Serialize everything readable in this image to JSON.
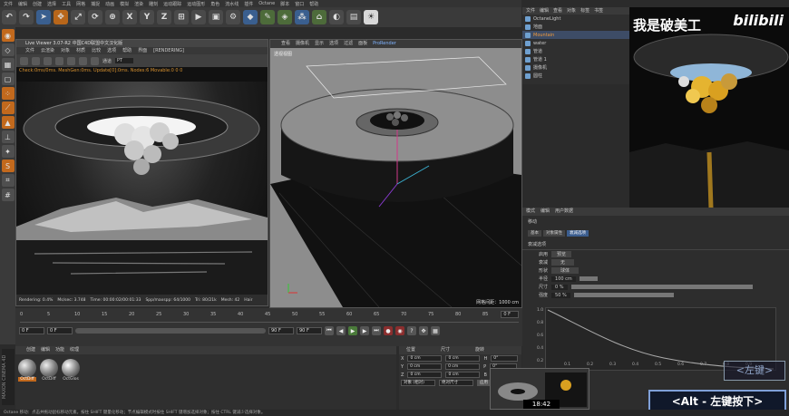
{
  "menu": {
    "items": [
      "文件",
      "编辑",
      "创建",
      "选择",
      "工具",
      "网格",
      "捕捉",
      "动画",
      "模拟",
      "渲染",
      "雕刻",
      "运动跟踪",
      "运动图形",
      "角色",
      "流水线",
      "插件",
      "Octane",
      "脚本",
      "窗口",
      "帮助"
    ]
  },
  "toolbar": {
    "axis": [
      "X",
      "Y",
      "Z"
    ]
  },
  "live_viewer": {
    "title": "Live Viewer 3.07-R2 中国C4D联盟中文汉化版",
    "menu": [
      "文件",
      "云渲染",
      "对象",
      "材质",
      "比较",
      "选项",
      "帮助",
      "界面"
    ],
    "status_tag": "[RENDERING]",
    "mode": "通道",
    "mode_value": "PT",
    "info": "Check:0ms/0ms. MeshGen:0ms. Update[0]:0ms. Nodes:6 Movable:0 0 0",
    "status": [
      "Rendering: 0.4%",
      "Ms/sec: 3.748",
      "Time: 00:00:02/00:01:33",
      "Spp/maxspp: 64/1000",
      "Tri: 80/21k",
      "Mesh: 42",
      "Hair"
    ]
  },
  "viewport": {
    "menu": [
      "查看",
      "摄像机",
      "显示",
      "选项",
      "过滤",
      "面板",
      "ProRender"
    ],
    "label": "透视视图",
    "grid": "网格间距：1000 cm"
  },
  "timeline": {
    "ticks": [
      "0",
      "5",
      "10",
      "15",
      "20",
      "25",
      "30",
      "35",
      "40",
      "45",
      "50",
      "55",
      "60",
      "65",
      "70",
      "75",
      "80",
      "85",
      "90"
    ],
    "start": "0 F",
    "mid": "0 F",
    "end": "90 F",
    "end2": "90 F",
    "current": "0 F"
  },
  "materials": {
    "tabs": [
      "创建",
      "编辑",
      "功能",
      "纹理"
    ],
    "items": [
      {
        "name": "OctDiff",
        "selected": true
      },
      {
        "name": "OctDiff",
        "selected": false
      },
      {
        "name": "OctGlos",
        "selected": false
      }
    ]
  },
  "coordinates": {
    "headers": [
      "位置",
      "尺寸",
      "旋转"
    ],
    "rows": [
      {
        "axis": "X",
        "pos": "0 cm",
        "size": "0 cm",
        "rot_label": "H",
        "rot": "0°"
      },
      {
        "axis": "Y",
        "pos": "0 cm",
        "size": "0 cm",
        "rot_label": "P",
        "rot": "0°"
      },
      {
        "axis": "Z",
        "pos": "0 cm",
        "size": "0 cm",
        "rot_label": "B",
        "rot": "0°"
      }
    ],
    "mode1": "对象 (相对)",
    "mode2": "绝对尺寸",
    "apply": "应用"
  },
  "objects": {
    "menu": [
      "文件",
      "编辑",
      "查看",
      "对象",
      "标签",
      "书签"
    ],
    "items": [
      {
        "name": "OctaneLight",
        "selected": false
      },
      {
        "name": "地面",
        "selected": false
      },
      {
        "name": "Mountain",
        "selected": true
      },
      {
        "name": "water",
        "selected": false
      },
      {
        "name": "管道",
        "selected": false
      },
      {
        "name": "管道 1",
        "selected": false
      },
      {
        "name": "摄像机",
        "selected": false
      },
      {
        "name": "圆柱",
        "selected": false
      }
    ]
  },
  "camera_preview": {
    "title": "我是破美工",
    "logo": "bilibili"
  },
  "attributes": {
    "tabs": [
      "模式",
      "编辑",
      "用户数据"
    ],
    "object": "移动",
    "subtabs": [
      "基本",
      "对象属性",
      "衰减选项"
    ],
    "section": "衰减选项",
    "rows": [
      {
        "label": "启用",
        "value": "预览"
      },
      {
        "label": "衰减",
        "value": "无"
      },
      {
        "label": "形状",
        "value": "球体"
      },
      {
        "label": "半径",
        "value": "100 cm"
      },
      {
        "label": "尺寸",
        "value": "0 %"
      },
      {
        "label": "强度",
        "value": "50 %"
      }
    ],
    "graph_y": [
      "1.0",
      "0.8",
      "0.6",
      "0.4",
      "0.2"
    ],
    "graph_x": [
      "0.1",
      "0.2",
      "0.3",
      "0.4",
      "0.5",
      "0.6",
      "0.7",
      "0.8",
      "0.9"
    ]
  },
  "hints": {
    "key1": "<左键>",
    "key2": "<Alt - 左键按下>"
  },
  "video": {
    "time": "18:42"
  },
  "statusbar": "Octane  移动：点击并拖动鼠标移动元素。按住 SHIFT 键量化移动；节点编辑模式时按住 SHIFT 键增加选择对象；按住 CTRL 键减少选择对象。",
  "brand": "MAXON CINEMA 4D"
}
